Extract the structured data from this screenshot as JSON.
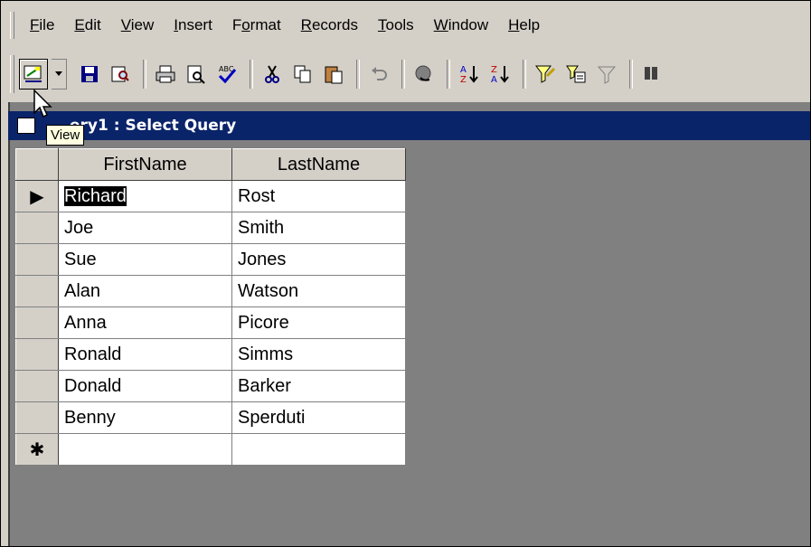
{
  "menu": {
    "items": [
      {
        "pre": "",
        "u": "F",
        "post": "ile"
      },
      {
        "pre": "",
        "u": "E",
        "post": "dit"
      },
      {
        "pre": "",
        "u": "V",
        "post": "iew"
      },
      {
        "pre": "",
        "u": "I",
        "post": "nsert"
      },
      {
        "pre": "F",
        "u": "o",
        "post": "rmat"
      },
      {
        "pre": "",
        "u": "R",
        "post": "ecords"
      },
      {
        "pre": "",
        "u": "T",
        "post": "ools"
      },
      {
        "pre": "",
        "u": "W",
        "post": "indow"
      },
      {
        "pre": "",
        "u": "H",
        "post": "elp"
      }
    ]
  },
  "toolbar": {
    "icons": [
      "view-icon",
      "save-icon",
      "search-icon",
      "print-icon",
      "print-preview-icon",
      "spelling-icon",
      "cut-icon",
      "copy-icon",
      "paste-icon",
      "undo-icon",
      "hyperlink-icon",
      "sort-ascending-icon",
      "sort-descending-icon",
      "filter-by-selection-icon",
      "filter-by-form-icon",
      "apply-filter-icon",
      "find-icon"
    ]
  },
  "tooltip": {
    "text": "View"
  },
  "window": {
    "title": "ery1 : Select Query"
  },
  "datasheet": {
    "columns": [
      "FirstName",
      "LastName"
    ],
    "current_row_marker": "▶",
    "new_row_marker": "✱",
    "rows": [
      [
        "Richard",
        "Rost"
      ],
      [
        "Joe",
        "Smith"
      ],
      [
        "Sue",
        "Jones"
      ],
      [
        "Alan",
        "Watson"
      ],
      [
        "Anna",
        "Picore"
      ],
      [
        "Ronald",
        "Simms"
      ],
      [
        "Donald",
        "Barker"
      ],
      [
        "Benny",
        "Sperduti"
      ]
    ]
  },
  "colors": {
    "titlebar": "#0a246a",
    "face": "#d4d0c8",
    "workspace": "#808080",
    "tooltip": "#ffffe1"
  }
}
